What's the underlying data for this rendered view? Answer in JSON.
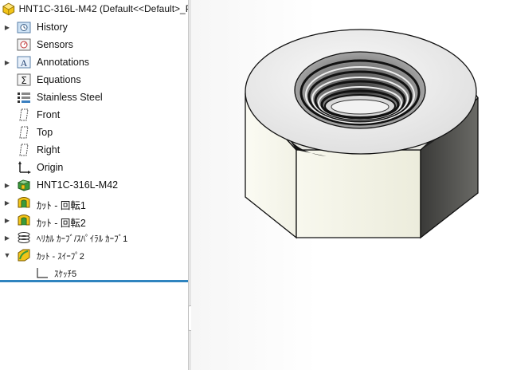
{
  "feature_tree": {
    "root_title": "HNT1C-316L-M42  (Default<<Default>_P",
    "items": [
      {
        "label": "History"
      },
      {
        "label": "Sensors"
      },
      {
        "label": "Annotations"
      },
      {
        "label": "Equations"
      },
      {
        "label": "Stainless Steel"
      },
      {
        "label": "Front"
      },
      {
        "label": "Top"
      },
      {
        "label": "Right"
      },
      {
        "label": "Origin"
      },
      {
        "label": "HNT1C-316L-M42"
      },
      {
        "label": "ｶｯﾄ - 回転1"
      },
      {
        "label": "ｶｯﾄ - 回転2"
      },
      {
        "label": "ﾍﾘｶﾙ ｶｰﾌﾞ/ｽﾊﾟｲﾗﾙ ｶｰﾌﾞ1"
      },
      {
        "label": "ｶｯﾄ - ｽｲｰﾌﾟ2"
      },
      {
        "label": "ｽｹｯﾁ5"
      }
    ]
  },
  "icons": {
    "part": "part-icon",
    "history": "history-folder-icon",
    "sensors": "sensor-icon",
    "annotations": "annotation-icon",
    "equations": "sigma-icon",
    "material": "material-icon",
    "plane": "plane-icon",
    "origin": "origin-icon",
    "body": "body-feature-icon",
    "cut_revolve": "cut-revolve-icon",
    "helix": "helix-icon",
    "cut_sweep": "cut-sweep-icon",
    "sketch": "sketch-icon"
  },
  "colors": {
    "accent": "#2f84bf",
    "feature_yellow": "#f2c418",
    "feature_green": "#3a9a3a"
  }
}
